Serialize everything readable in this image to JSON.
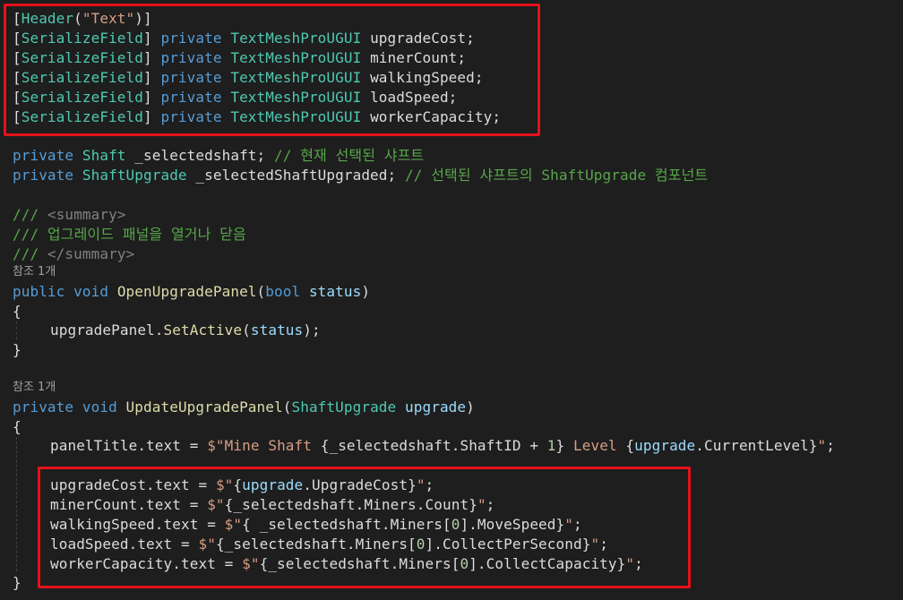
{
  "code": {
    "header_attr": [
      "[",
      "Header",
      "(",
      "\"Text\"",
      ")]"
    ],
    "fields": [
      {
        "attr": "SerializeField",
        "mod": "private",
        "type": "TextMeshProUGUI",
        "name": "upgradeCost;"
      },
      {
        "attr": "SerializeField",
        "mod": "private",
        "type": "TextMeshProUGUI",
        "name": "minerCount;"
      },
      {
        "attr": "SerializeField",
        "mod": "private",
        "type": "TextMeshProUGUI",
        "name": "walkingSpeed;"
      },
      {
        "attr": "SerializeField",
        "mod": "private",
        "type": "TextMeshProUGUI",
        "name": "loadSpeed;"
      },
      {
        "attr": "SerializeField",
        "mod": "private",
        "type": "TextMeshProUGUI",
        "name": "workerCapacity;"
      }
    ],
    "private_kw": "private",
    "shaft_type": "Shaft",
    "shaft_field": " _selectedshaft;",
    "shaft_comment": "// 현재 선택된 샤프트",
    "upgrade_type": "ShaftUpgrade",
    "upgrade_field": " _selectedShaftUpgraded;",
    "upgrade_comment": "// 선택된 샤프트의 ShaftUpgrade 컴포넌트",
    "doc_open_prefix": "///",
    "doc_open_tag": " <summary>",
    "doc_text": "/// 업그레이드 패널을 열거나 닫음",
    "doc_close_prefix": "///",
    "doc_close_tag": " </summary>",
    "ref_count_1": "참조 1개",
    "method1": {
      "public": "public",
      "void": "void",
      "name": "OpenUpgradePanel",
      "ptype": "bool",
      "pname": "status"
    },
    "brace_open": "{",
    "brace_close": "}",
    "method1_body": {
      "obj": "upgradePanel.",
      "call": "SetActive",
      "arg": "status",
      "end": ");"
    },
    "ref_count_2": "참조 1개",
    "method2": {
      "private": "private",
      "void": "void",
      "name": "UpdateUpgradePanel",
      "ptype": "ShaftUpgrade",
      "pname": "upgrade"
    },
    "panel_title_line": {
      "lhs": "panelTitle.text = ",
      "s1": "$\"Mine Shaft ",
      "e1": "{_selectedshaft.ShaftID + ",
      "n1": "1",
      "e1b": "}",
      "s2": " Level ",
      "e2a": "{",
      "e2p": "upgrade",
      "e2b": ".CurrentLevel}",
      "s3": "\"",
      "end": ";"
    },
    "assign_lines": [
      {
        "lhs": "upgradeCost.text = ",
        "q1": "$\"",
        "expr_a": "{",
        "param": "upgrade",
        "expr_b": ".UpgradeCost}",
        "q2": "\"",
        "end": ";"
      },
      {
        "lhs": "minerCount.text = ",
        "q1": "$\"",
        "expr_a": "{_selectedshaft.Miners.Count}",
        "param": "",
        "expr_b": "",
        "q2": "\"",
        "end": ";"
      },
      {
        "lhs": "walkingSpeed.text = ",
        "q1": "$\"",
        "expr_a": "{ _selectedshaft.Miners[",
        "param": "",
        "expr_b": "",
        "q2": "",
        "end": ""
      },
      {
        "lhs": "loadSpeed.text = ",
        "q1": "$\"",
        "expr_a": "{_selectedshaft.Miners[",
        "param": "",
        "expr_b": "",
        "q2": "",
        "end": ""
      },
      {
        "lhs": "workerCapacity.text = ",
        "q1": "$\"",
        "expr_a": "{_selectedshaft.Miners[",
        "param": "",
        "expr_b": "",
        "q2": "",
        "end": ""
      }
    ],
    "walking_rest": {
      "n": "0",
      "tail": "].MoveSpeed}",
      "q": "\"",
      "end": ";"
    },
    "load_rest": {
      "n": "0",
      "tail": "].CollectPerSecond}",
      "q": "\"",
      "end": ";"
    },
    "capacity_rest": {
      "n": "0",
      "tail": "].CollectCapacity}",
      "q": "\"",
      "end": ";"
    }
  },
  "colors": {
    "highlight": "#e5121b",
    "background": "#1e1e1e"
  }
}
